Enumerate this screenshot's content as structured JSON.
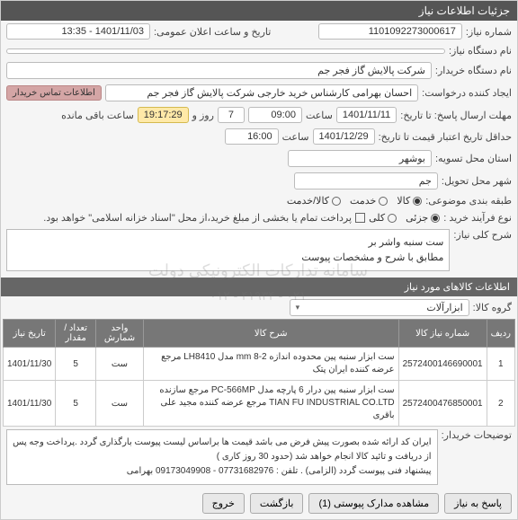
{
  "header": {
    "title": "جزئیات اطلاعات نیاز"
  },
  "fields": {
    "need_number_label": "شماره نیاز:",
    "need_number": "1101092273000617",
    "announce_label": "تاریخ و ساعت اعلان عمومی:",
    "announce_value": "1401/11/03 - 13:35",
    "device_label": "نام دستگاه نیاز:",
    "buyer_label": "نام دستگاه خریدار:",
    "buyer_value": "شرکت پالایش گاز فجر جم",
    "requester_label": "ایجاد کننده درخواست:",
    "requester_value": "احسان بهرامی کارشناس خرید خارجی شرکت پالایش گاز فجر جم",
    "contact_btn": "اطلاعات تماس خریدار",
    "deadline_label": "مهلت ارسال پاسخ: تا تاریخ:",
    "deadline_date": "1401/11/11",
    "time_label": "ساعت",
    "deadline_time": "09:00",
    "days_remain": "7",
    "days_label": "روز و",
    "time_remain": "19:17:29",
    "remain_label": "ساعت باقی مانده",
    "validity_label": "حداقل تاریخ اعتبار قیمت تا تاریخ:",
    "validity_date": "1401/12/29",
    "validity_time": "16:00",
    "province_label": "استان محل تسویه:",
    "province_value": "بوشهر",
    "city_label": "شهر محل تحویل:",
    "city_value": "جم",
    "topic_label": "طبقه بندی موضوعی:",
    "topic_goods": "کالا",
    "topic_service": "خدمت",
    "topic_gs": "کالا/خدمت",
    "purchase_type_label": "نوع فرآیند خرید :",
    "purchase_partial": "جزئی",
    "purchase_full": "کلی",
    "payment_note": "پرداخت تمام یا بخشی از مبلغ خرید،از محل \"اسناد خزانه اسلامی\" خواهد بود.",
    "need_desc_label": "شرح کلی نیاز:",
    "need_desc_line1": "ست سنبه واشر بر",
    "need_desc_line2": "مطابق با شرح و مشخصات پیوست"
  },
  "goods_section": {
    "title": "اطلاعات کالاهای مورد نیاز",
    "group_label": "گروه کالا:",
    "group_value": "ابزارآلات"
  },
  "table": {
    "headers": [
      "ردیف",
      "شماره نیاز کالا",
      "شرح کالا",
      "واحد شمارش",
      "تعداد / مقدار",
      "تاریخ نیاز"
    ],
    "rows": [
      {
        "idx": "1",
        "code": "2572400146690001",
        "desc": "ست ابزار سنبه پین محدوده اندازه mm 8-2 مدل LH8410 مرجع عرضه کننده ایران پتک",
        "unit": "ست",
        "qty": "5",
        "date": "1401/11/30"
      },
      {
        "idx": "2",
        "code": "2572400476850001",
        "desc": "ست ابزار سنبه پین درار 6 پارچه مدل PC-566MP مرجع سازنده TIAN FU INDUSTRIAL CO.LTD مرجع عرضه کننده مجید علی باقری",
        "unit": "ست",
        "qty": "5",
        "date": "1401/11/30"
      }
    ]
  },
  "notes": {
    "label": "توضیحات خریدار:",
    "text": "ایران کد ارائه شده بصورت پیش فرض می باشد قیمت ها براساس لیست پیوست بارگذاری گردد .پرداخت وجه پس از دریافت و تائید کالا انجام خواهد شد (حدود 30 روز کاری )\nپیشنهاد فنی پیوست گردد (الزامی) . تلفن : 07731682976 - 09173049908 بهرامی"
  },
  "footer": {
    "reply": "پاسخ به نیاز",
    "attachments": "مشاهده مدارک پیوستی (1)",
    "back": "بازگشت",
    "close": "خروج"
  },
  "watermark": {
    "line1": "سامانه تدارکات الکترونیکی دولت",
    "line2": "۰۲۱ - ۴۱۹۳۴ - ۰۱۲"
  }
}
